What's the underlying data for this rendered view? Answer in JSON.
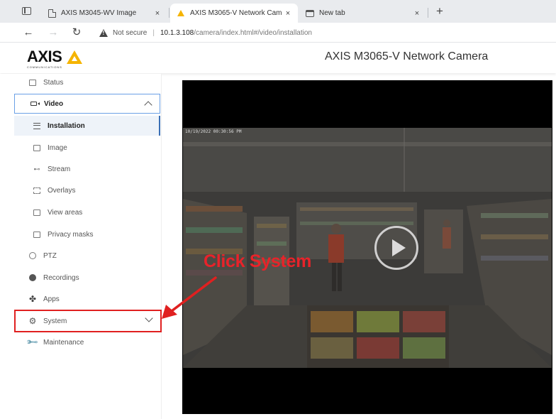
{
  "browser": {
    "tabs": [
      {
        "title": "AXIS M3045-WV Image",
        "close": "×",
        "icon": "page-icon"
      },
      {
        "title": "AXIS M3065-V Network Camera",
        "close": "×",
        "icon": "axis-favicon"
      },
      {
        "title": "New tab",
        "close": "×",
        "icon": "newtab-icon"
      }
    ],
    "new_tab_label": "+",
    "nav": {
      "back": "←",
      "forward": "→",
      "reload": "↻"
    },
    "address": {
      "security_label": "Not secure",
      "separator": "|",
      "url_host": "10.1.3.108",
      "url_path": "/camera/index.html#/video/installation"
    }
  },
  "header": {
    "logo_text": "AXIS",
    "logo_sub": "COMMUNICATIONS",
    "device_title": "AXIS M3065-V Network Camera"
  },
  "sidebar": {
    "items": [
      {
        "label": "Status",
        "icon": "status-icon"
      },
      {
        "label": "Video",
        "icon": "video-icon",
        "expanded": true
      },
      {
        "label": "Installation",
        "icon": "installation-icon",
        "active": true
      },
      {
        "label": "Image",
        "icon": "image-icon"
      },
      {
        "label": "Stream",
        "icon": "stream-icon"
      },
      {
        "label": "Overlays",
        "icon": "overlays-icon"
      },
      {
        "label": "View areas",
        "icon": "view-areas-icon"
      },
      {
        "label": "Privacy masks",
        "icon": "privacy-masks-icon"
      },
      {
        "label": "PTZ",
        "icon": "ptz-icon"
      },
      {
        "label": "Recordings",
        "icon": "recordings-icon"
      },
      {
        "label": "Apps",
        "icon": "apps-icon"
      },
      {
        "label": "System",
        "icon": "system-icon",
        "expanded": false
      },
      {
        "label": "Maintenance",
        "icon": "maintenance-icon"
      }
    ]
  },
  "video": {
    "timestamp": "10/19/2022 00:30:56 PM"
  },
  "annotation": {
    "callout": "Click System",
    "color": "#e8232a"
  }
}
